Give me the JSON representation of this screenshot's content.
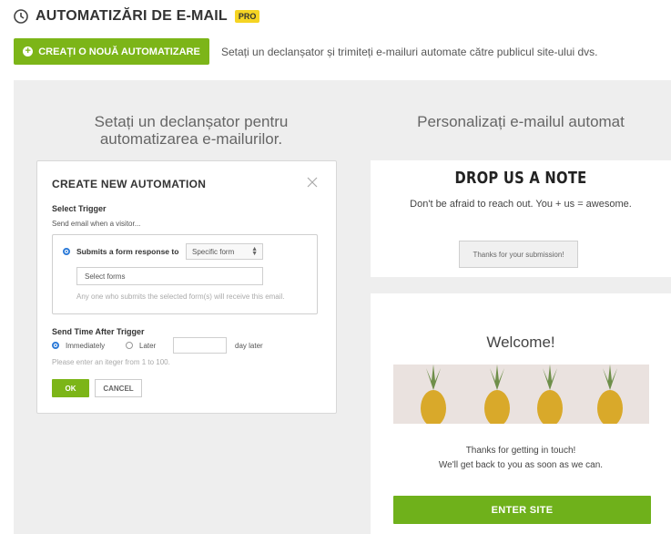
{
  "header": {
    "title": "AUTOMATIZĂRI DE E-MAIL",
    "badge": "PRO",
    "create_button": "CREAȚI O NOUĂ AUTOMATIZARE",
    "description": "Setați un declanșator și trimiteți e-mailuri automate către publicul site-ului dvs."
  },
  "left_panel": {
    "heading_line1": "Setați un declanșator pentru",
    "heading_line2": "automatizarea e-mailurilor."
  },
  "modal": {
    "title": "CREATE NEW AUTOMATION",
    "select_trigger_label": "Select Trigger",
    "trigger_hint": "Send email when a visitor...",
    "option_label": "Submits a form response to",
    "form_select_value": "Specific form",
    "forms_placeholder": "Select forms",
    "forms_note": "Any one who submits the selected form(s) will receive this email.",
    "send_time_label": "Send Time After Trigger",
    "immediately_label": "Immediately",
    "later_label": "Later",
    "day_later_label": "day later",
    "integer_hint": "Please enter an iteger  from 1 to 100.",
    "ok_label": "OK",
    "cancel_label": "CANCEL"
  },
  "right_panel": {
    "heading": "Personalizați e-mailul automat",
    "form_preview": {
      "title": "DROP US A NOTE",
      "subtitle": "Don't be afraid to reach out. You + us = awesome.",
      "thanks_button": "Thanks for your submission!"
    },
    "email_preview": {
      "title": "Welcome!",
      "message_line1": "Thanks for getting in touch!",
      "message_line2": "We'll get back to you as soon as we can.",
      "cta": "ENTER SITE"
    }
  },
  "colors": {
    "accent_green": "#7cb518",
    "badge_yellow": "#f5d423",
    "panel_gray": "#eeeeee",
    "radio_blue": "#2d7bd8"
  }
}
